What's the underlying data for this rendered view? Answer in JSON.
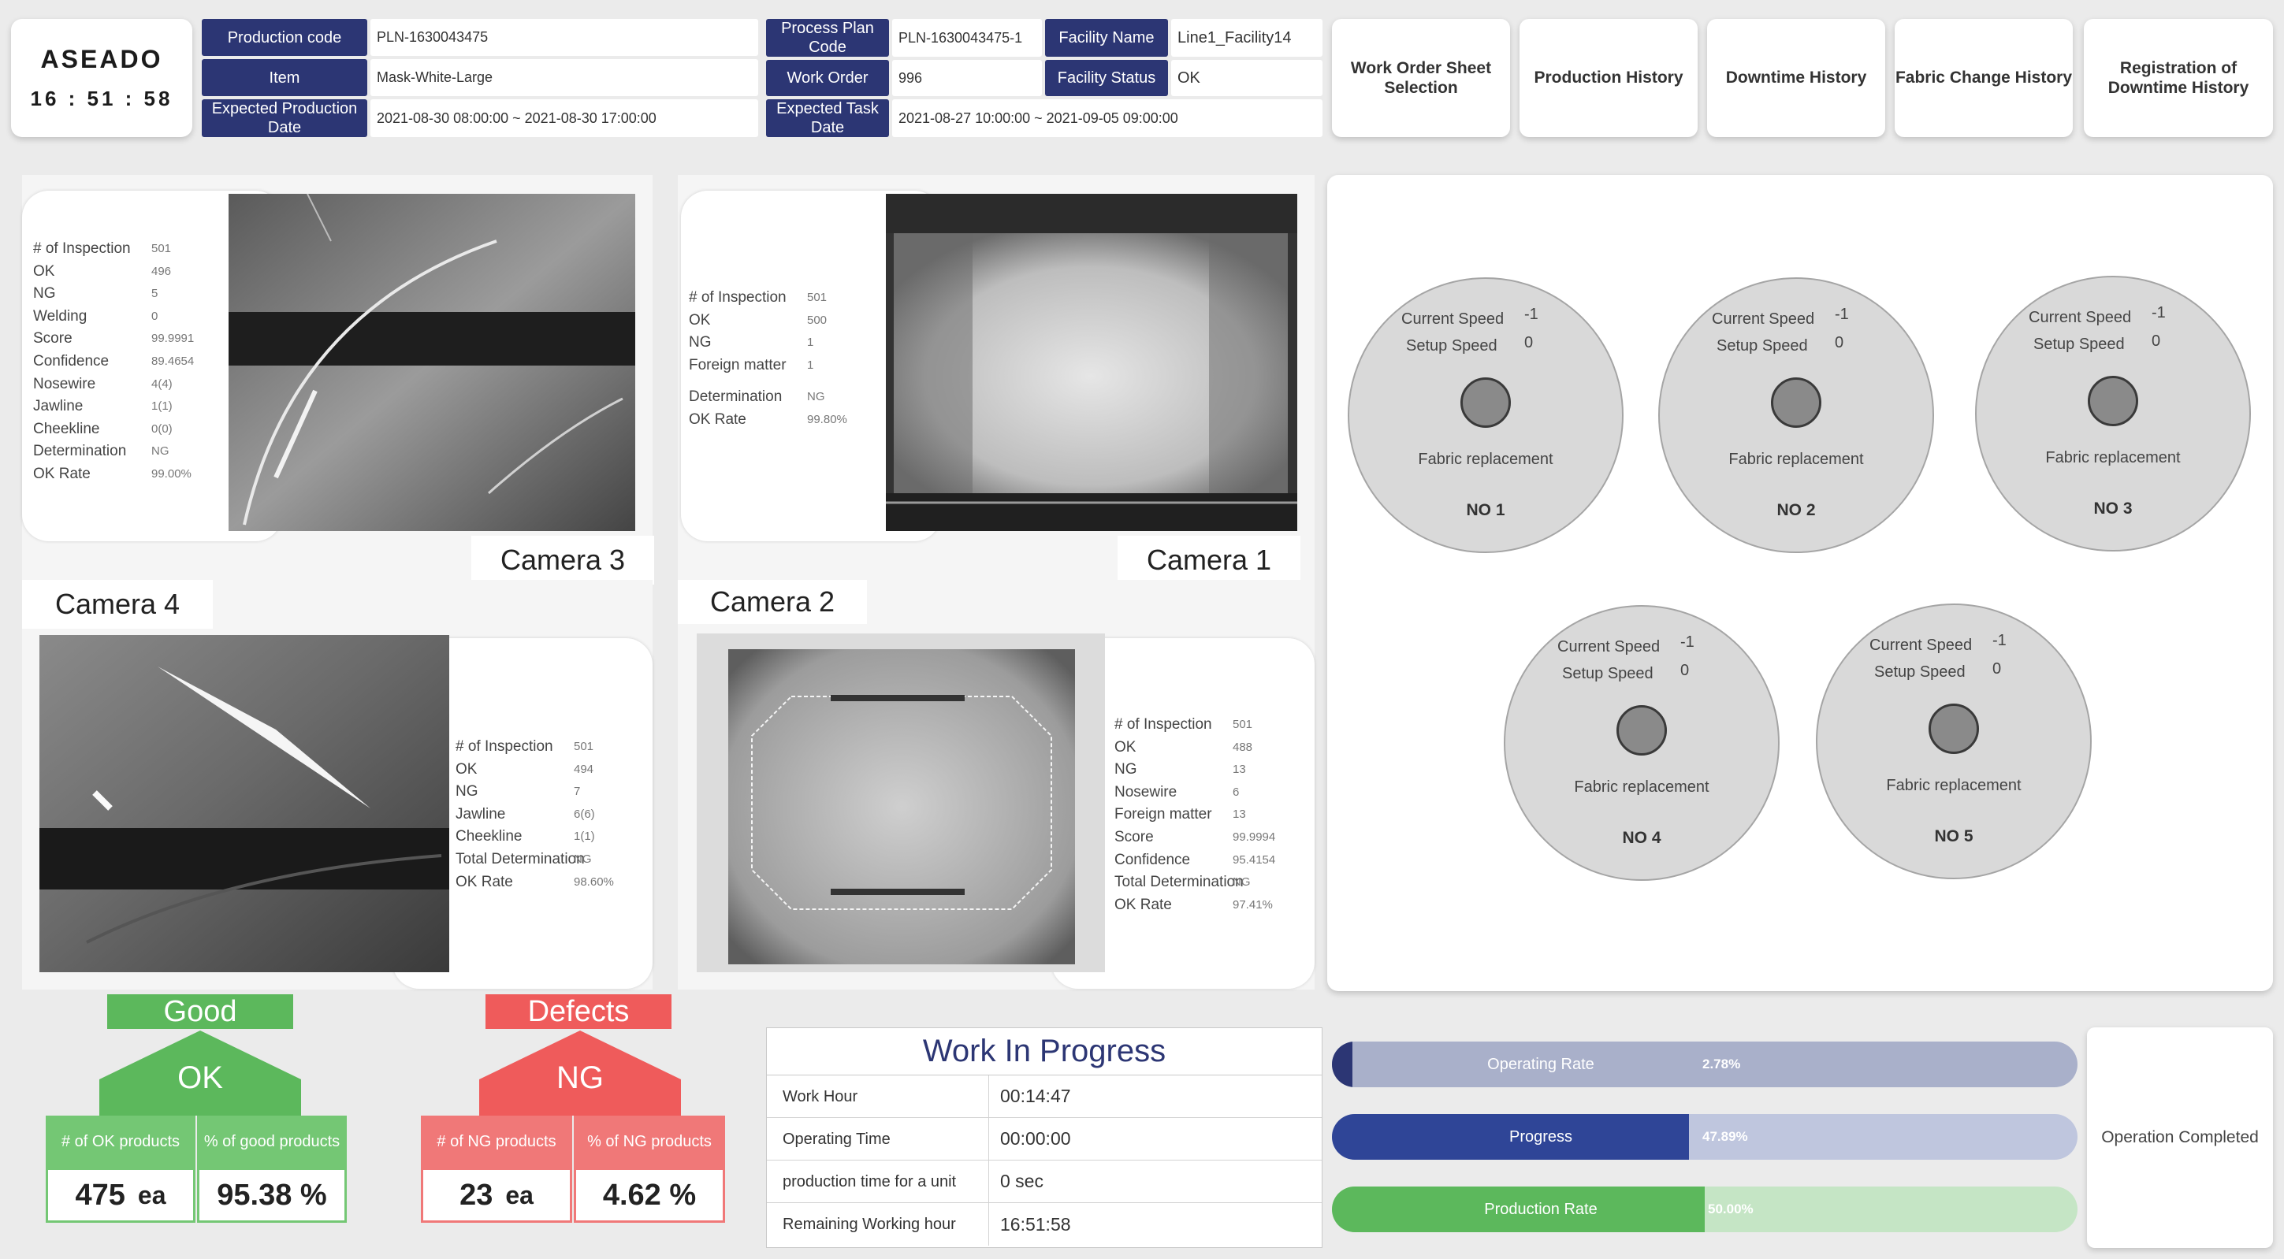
{
  "header": {
    "logo": "ASEADO",
    "clock": "16 : 51 : 58",
    "production_code_label": "Production code",
    "production_code": "PLN-1630043475",
    "item_label": "Item",
    "item": "Mask-White-Large",
    "expected_date_label": "Expected Production Date",
    "expected_date": "2021-08-30 08:00:00 ~ 2021-08-30 17:00:00",
    "plan_code_label": "Process Plan Code",
    "plan_code": "PLN-1630043475-1",
    "facility_name_label": "Facility Name",
    "facility_name": "Line1_Facility14",
    "work_order_label": "Work Order",
    "work_order": "996",
    "facility_status_label": "Facility Status",
    "facility_status": "OK",
    "task_date_label": "Expected Task Date",
    "task_date": "2021-08-27 10:00:00 ~ 2021-09-05 09:00:00"
  },
  "nav": [
    "Work Order Sheet Selection",
    "Production History",
    "Downtime History",
    "Fabric Change History",
    "Registration of Downtime History"
  ],
  "cameras": {
    "cam3": {
      "label": "Camera 3",
      "stats": [
        {
          "k": "# of Inspection",
          "v": "501"
        },
        {
          "k": "OK",
          "v": "496"
        },
        {
          "k": "NG",
          "v": "5"
        },
        {
          "k": "Welding",
          "v": "0"
        },
        {
          "k": "Score",
          "v": "99.9991"
        },
        {
          "k": "Confidence",
          "v": "89.4654"
        },
        {
          "k": "Nosewire",
          "v": "4(4)"
        },
        {
          "k": "Jawline",
          "v": "1(1)"
        },
        {
          "k": "Cheekline",
          "v": "0(0)"
        },
        {
          "k": "Determination",
          "v": "NG"
        },
        {
          "k": "OK Rate",
          "v": "99.00%"
        }
      ]
    },
    "cam1": {
      "label": "Camera 1",
      "stats": [
        {
          "k": "# of Inspection",
          "v": "501"
        },
        {
          "k": "OK",
          "v": "500"
        },
        {
          "k": "NG",
          "v": "1"
        },
        {
          "k": "Foreign matter",
          "v": "1"
        },
        {
          "k": "",
          "v": ""
        },
        {
          "k": "Determination",
          "v": "NG"
        },
        {
          "k": "OK Rate",
          "v": "99.80%"
        }
      ]
    },
    "cam4": {
      "label": "Camera 4",
      "stats": [
        {
          "k": "# of Inspection",
          "v": "501"
        },
        {
          "k": "OK",
          "v": "494"
        },
        {
          "k": "NG",
          "v": "7"
        },
        {
          "k": "Jawline",
          "v": "6(6)"
        },
        {
          "k": "Cheekline",
          "v": "1(1)"
        },
        {
          "k": "Total Determination",
          "v": "NG"
        },
        {
          "k": "OK Rate",
          "v": "98.60%"
        }
      ]
    },
    "cam2": {
      "label": "Camera 2",
      "stats": [
        {
          "k": "# of Inspection",
          "v": "501"
        },
        {
          "k": "OK",
          "v": "488"
        },
        {
          "k": "NG",
          "v": "13"
        },
        {
          "k": "Nosewire",
          "v": "6"
        },
        {
          "k": "Foreign matter",
          "v": "13"
        },
        {
          "k": "Score",
          "v": "99.9994"
        },
        {
          "k": "Confidence",
          "v": "95.4154"
        },
        {
          "k": "Total Determination",
          "v": "NG"
        },
        {
          "k": "OK Rate",
          "v": "97.41%"
        }
      ]
    }
  },
  "dials": [
    {
      "no": "NO 1",
      "current_label": "Current Speed",
      "current": "-1",
      "setup_label": "Setup Speed",
      "setup": "0",
      "replace": "Fabric replacement"
    },
    {
      "no": "NO 2",
      "current_label": "Current Speed",
      "current": "-1",
      "setup_label": "Setup Speed",
      "setup": "0",
      "replace": "Fabric replacement"
    },
    {
      "no": "NO 3",
      "current_label": "Current Speed",
      "current": "-1",
      "setup_label": "Setup Speed",
      "setup": "0",
      "replace": "Fabric replacement"
    },
    {
      "no": "NO 4",
      "current_label": "Current Speed",
      "current": "-1",
      "setup_label": "Setup Speed",
      "setup": "0",
      "replace": "Fabric replacement"
    },
    {
      "no": "NO 5",
      "current_label": "Current Speed",
      "current": "-1",
      "setup_label": "Setup Speed",
      "setup": "0",
      "replace": "Fabric replacement"
    }
  ],
  "good": {
    "title": "Good",
    "badge": "OK",
    "count_label": "# of OK products",
    "pct_label": "% of good products",
    "count": "475",
    "count_unit": "ea",
    "pct": "95.38 %"
  },
  "defects": {
    "title": "Defects",
    "badge": "NG",
    "count_label": "# of NG products",
    "pct_label": "% of NG products",
    "count": "23",
    "count_unit": "ea",
    "pct": "4.62 %"
  },
  "wip": {
    "title": "Work In Progress",
    "rows": [
      {
        "k": "Work Hour",
        "v": "00:14:47"
      },
      {
        "k": "Operating Time",
        "v": "00:00:00"
      },
      {
        "k": "production time for a unit",
        "v": "0 sec"
      },
      {
        "k": "Remaining Working hour",
        "v": "16:51:58"
      }
    ]
  },
  "bars": [
    {
      "name": "Operating Rate",
      "pct": "2.78%",
      "value": 0.0278,
      "bg": "#a9b0ca",
      "fill": "#2c3674"
    },
    {
      "name": "Progress",
      "pct": "47.89%",
      "value": 0.4789,
      "bg": "#bfc6de",
      "fill": "#2f4597"
    },
    {
      "name": "Production Rate",
      "pct": "50.00%",
      "value": 0.5,
      "bg": "#c5e5c5",
      "fill": "#5cb85c"
    }
  ],
  "operation_status": "Operation Completed",
  "colors": {
    "navy": "#2c3674",
    "good_green": "#5cb85c",
    "defect_red": "#ef5b5b"
  }
}
